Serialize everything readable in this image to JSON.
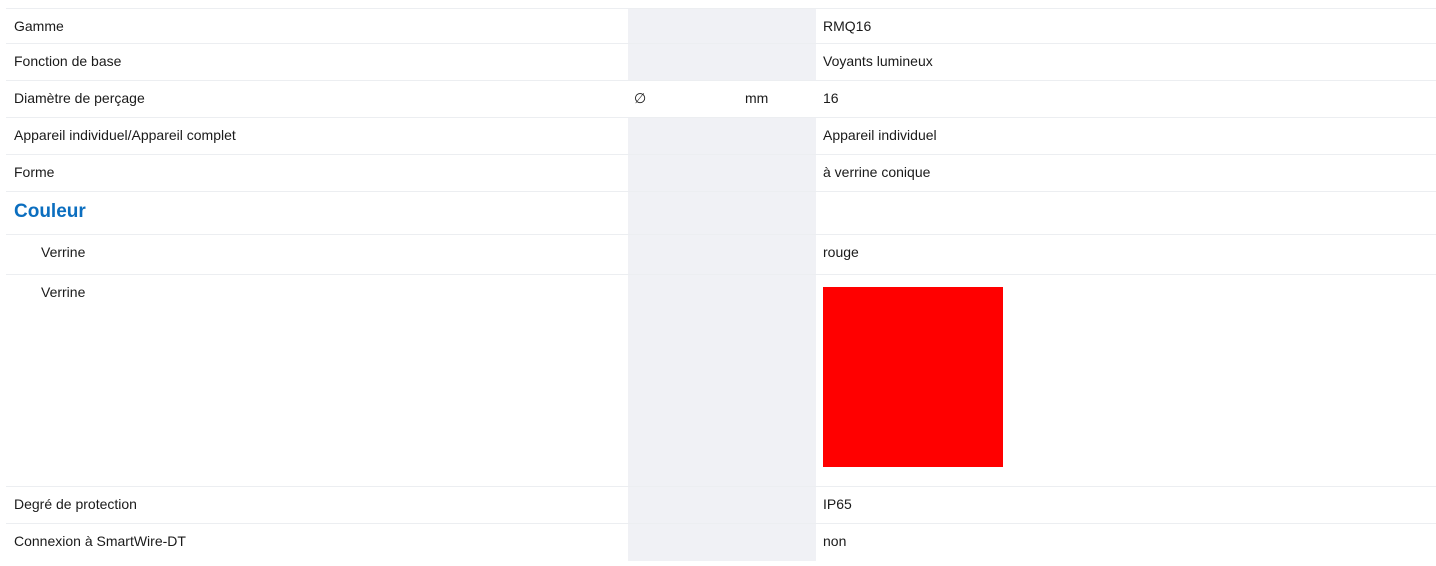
{
  "rows": [
    {
      "label": "Gamme",
      "symbol": "",
      "unit": "",
      "value": "RMQ16"
    },
    {
      "label": "Fonction de base",
      "symbol": "",
      "unit": "",
      "value": "Voyants lumineux"
    },
    {
      "label": "Diamètre de perçage",
      "symbol": "∅",
      "unit": "mm",
      "value": "16"
    },
    {
      "label": "Appareil individuel/Appareil complet",
      "symbol": "",
      "unit": "",
      "value": "Appareil individuel"
    },
    {
      "label": "Forme",
      "symbol": "",
      "unit": "",
      "value": "à verrine conique"
    }
  ],
  "section": {
    "title": "Couleur"
  },
  "color_rows": [
    {
      "label": "Verrine",
      "value": "rouge"
    },
    {
      "label": "Verrine",
      "swatch_color": "#ff0000"
    }
  ],
  "rows_after": [
    {
      "label": "Degré de protection",
      "value": "IP65"
    },
    {
      "label": "Connexion à SmartWire-DT",
      "value": "non"
    }
  ],
  "colors": {
    "section_heading": "#0b6ebf",
    "shaded_column": "#f0f1f5",
    "divider": "#eceef1"
  }
}
